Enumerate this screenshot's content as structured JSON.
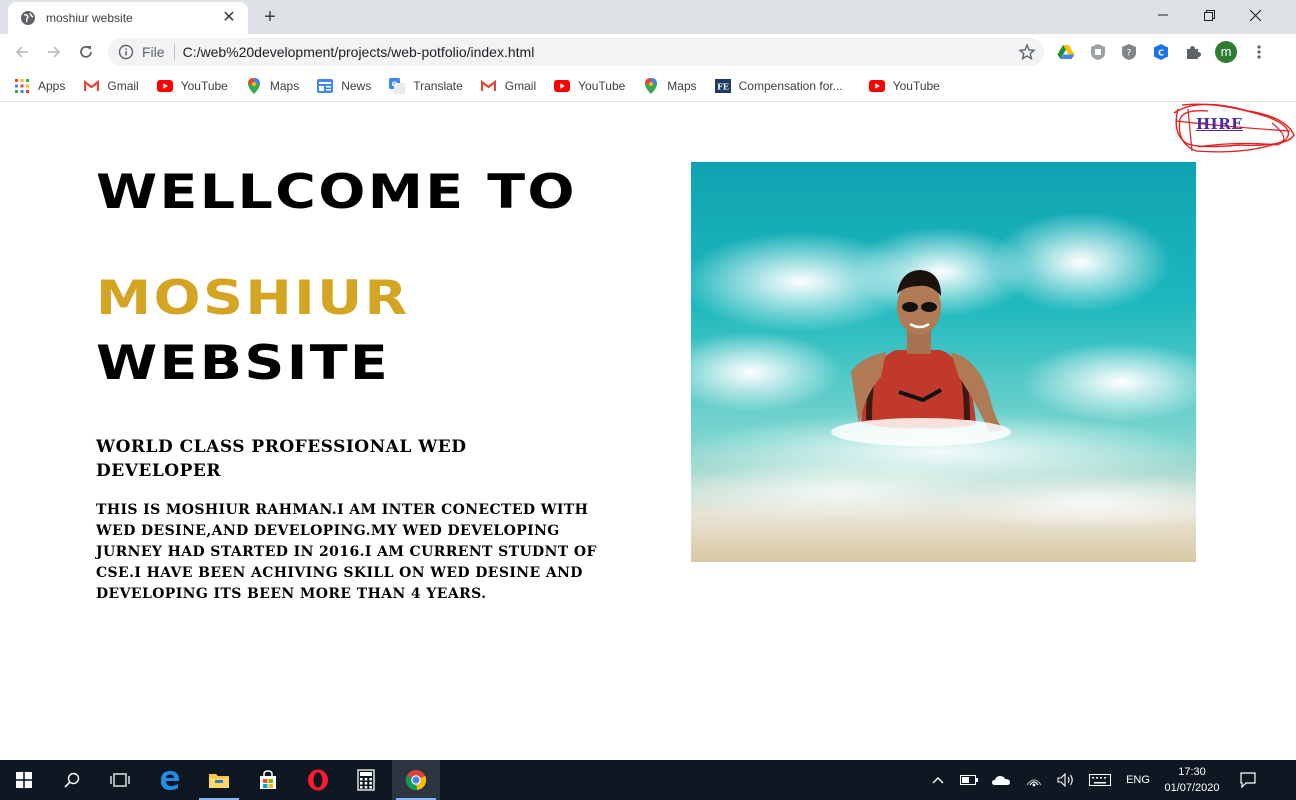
{
  "browser": {
    "tab_title": "moshiur website",
    "new_tab_symbol": "+",
    "address": {
      "scheme_label": "File",
      "url": "C:/web%20development/projects/web-potfolio/index.html"
    },
    "profile_initial": "m",
    "bookmarks": [
      {
        "label": "Apps",
        "icon": "apps-grid-icon"
      },
      {
        "label": "Gmail",
        "icon": "gmail-icon"
      },
      {
        "label": "YouTube",
        "icon": "youtube-icon"
      },
      {
        "label": "Maps",
        "icon": "maps-pin-icon"
      },
      {
        "label": "News",
        "icon": "news-icon"
      },
      {
        "label": "Translate",
        "icon": "translate-icon"
      },
      {
        "label": "Gmail",
        "icon": "gmail-icon"
      },
      {
        "label": "YouTube",
        "icon": "youtube-icon"
      },
      {
        "label": "Maps",
        "icon": "maps-pin-icon"
      },
      {
        "label": "Compensation for...",
        "icon": "fe-icon"
      },
      {
        "label": "YouTube",
        "icon": "youtube-icon"
      }
    ]
  },
  "page": {
    "hire_link": "HIRE",
    "heading_line1": "WELLCOME TO",
    "heading_name": "MOSHIUR",
    "heading_line3": "WEBSITE",
    "subheading": "WORLD CLASS PROFESSIONAL WED DEVELOPER",
    "bio": "THIS IS MOSHIUR RAHMAN.I AM INTER CONECTED WITH WED DESINE,AND DEVELOPING.MY WED DEVELOPING JURNEY HAD STARTED IN 2016.I AM CURRENT STUDNT OF CSE.I HAVE BEEN ACHIVING SKILL ON WED DESINE AND DEVELOPING ITS BEEN MORE THAN 4 YEARS.",
    "colors": {
      "name_accent": "#d4a423",
      "hire_link": "#4b2aa8",
      "hire_scribble": "#e02020"
    }
  },
  "taskbar": {
    "language": "ENG",
    "time": "17:30",
    "date": "01/07/2020"
  }
}
